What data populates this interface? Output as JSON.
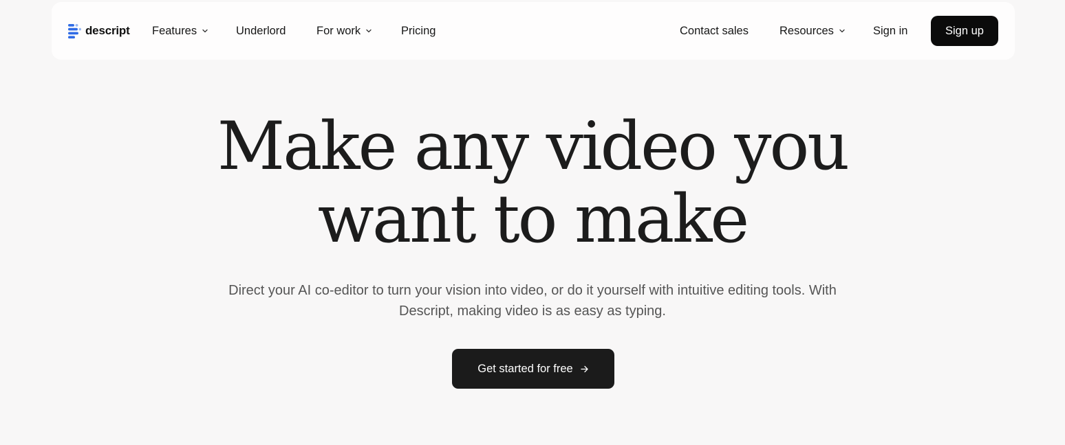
{
  "header": {
    "logo_text": "descript",
    "logo_icon": "descript-logo-icon",
    "nav_left": [
      {
        "label": "Features",
        "has_dropdown": true
      },
      {
        "label": "Underlord",
        "has_dropdown": false
      },
      {
        "label": "For work",
        "has_dropdown": true
      },
      {
        "label": "Pricing",
        "has_dropdown": false
      }
    ],
    "nav_right": [
      {
        "label": "Contact sales",
        "has_dropdown": false
      },
      {
        "label": "Resources",
        "has_dropdown": true
      },
      {
        "label": "Sign in",
        "has_dropdown": false
      }
    ],
    "signup_label": "Sign up"
  },
  "hero": {
    "title_line1": "Make any video you",
    "title_line2": "want to make",
    "subtitle": "Direct your AI co-editor to turn your vision into video, or do it yourself with intuitive editing tools. With Descript, making video is as easy as typing.",
    "cta_label": "Get started for free",
    "cta_icon": "arrow-right-icon"
  },
  "colors": {
    "page_background": "#f8f7f7",
    "navbar_background": "#fefdfd",
    "primary_button": "#0b0b0b",
    "cta_button": "#1b1b1b",
    "logo_accent": "#2f6be5"
  }
}
